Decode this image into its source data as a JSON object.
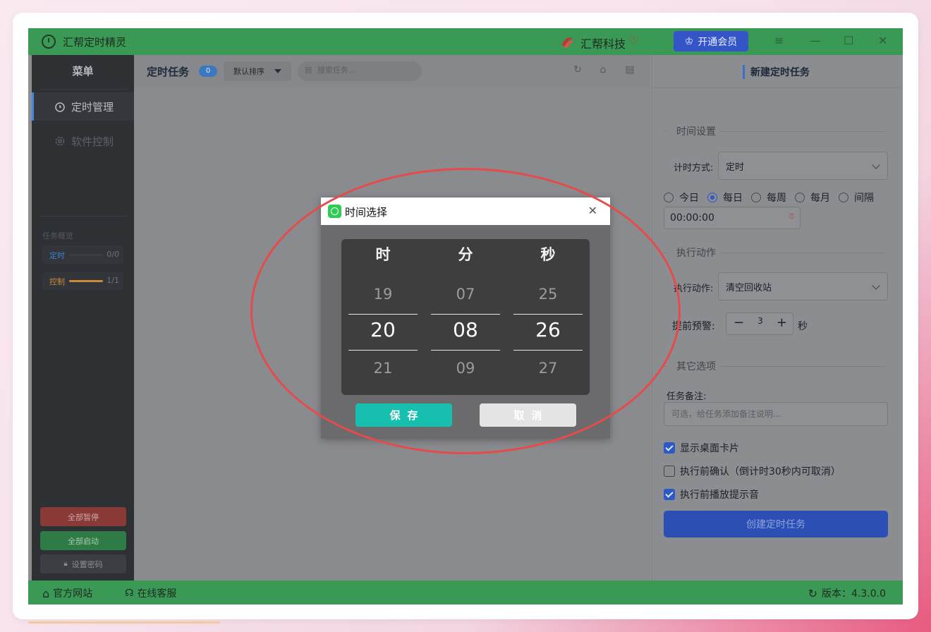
{
  "app": {
    "title": "汇帮定时精灵",
    "brand": "汇帮科技",
    "vip_label": "开通会员"
  },
  "sidebar": {
    "menu_title": "菜单",
    "nav": [
      {
        "label": "定时管理",
        "active": true
      },
      {
        "label": "软件控制",
        "active": false
      }
    ],
    "overview_title": "任务概览",
    "stats": [
      {
        "name": "定时",
        "value": "0/0",
        "progress": 0,
        "color": "#3f7fd0"
      },
      {
        "name": "控制",
        "value": "1/1",
        "progress": 1,
        "color": "#c98a3a"
      }
    ],
    "buttons": [
      {
        "label": "全部暂停",
        "bg": "#8a3a36",
        "color": "#caa8a5"
      },
      {
        "label": "全部启动",
        "bg": "#2f7b45",
        "color": "#a9cbb2"
      },
      {
        "label": "设置密码",
        "bg": "#3b3f44",
        "color": "#8b8f94"
      }
    ]
  },
  "toolbar": {
    "title": "定时任务",
    "count": "0",
    "sort_label": "默认排序",
    "search_placeholder": "搜索任务..."
  },
  "right_panel": {
    "title": "新建定时任务",
    "section_time": "时间设置",
    "mode_label": "计时方式:",
    "mode_value": "定时",
    "frequency_options": [
      "今日",
      "每日",
      "每周",
      "每月",
      "间隔"
    ],
    "frequency_selected": "每日",
    "time_value": "00:00:00",
    "section_action": "执行动作",
    "action_label": "执行动作:",
    "action_value": "清空回收站",
    "warn_label": "提前预警:",
    "warn_value": "3",
    "warn_unit": "秒",
    "section_other": "其它选项",
    "note_label": "任务备注:",
    "note_placeholder": "可选，给任务添加备注说明...",
    "checks": [
      {
        "label": "显示桌面卡片",
        "checked": true
      },
      {
        "label": "执行前确认（倒计时30秒内可取消）",
        "checked": false
      },
      {
        "label": "执行前播放提示音",
        "checked": true
      }
    ],
    "create_label": "创建定时任务"
  },
  "status_bar": {
    "website": "官方网站",
    "support": "在线客服",
    "version": "版本：4.3.0.0"
  },
  "dialog": {
    "title": "时间选择",
    "columns": [
      {
        "header": "时",
        "prev": "19",
        "current": "20",
        "next": "21"
      },
      {
        "header": "分",
        "prev": "07",
        "current": "08",
        "next": "09"
      },
      {
        "header": "秒",
        "prev": "25",
        "current": "26",
        "next": "27"
      }
    ],
    "save_label": "保存",
    "cancel_label": "取消"
  },
  "colors": {
    "accent_green": "#3a9a55",
    "primary_blue": "#2c4fb6",
    "save_teal": "#17bfae",
    "highlight_red": "#e54b4b"
  }
}
